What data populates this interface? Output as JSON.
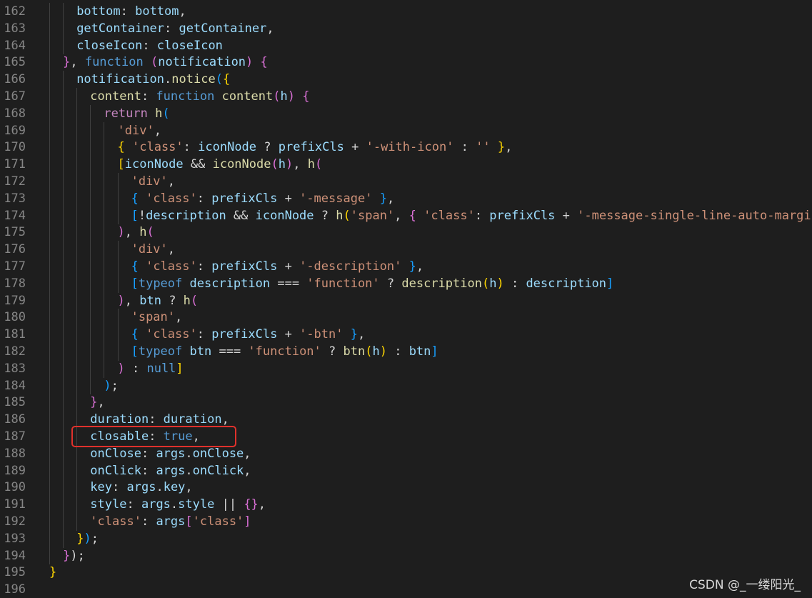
{
  "colors": {
    "default": "#d4d4d4",
    "variable": "#9cdcfe",
    "function": "#dcdcaa",
    "keyword": "#569cd6",
    "control": "#c586c0",
    "string": "#ce9178",
    "bracket1": "#ffd700",
    "bracket2": "#da70d6",
    "bracket3": "#179fff",
    "operator": "#d4d4d4",
    "highlight_border": "#e0312c"
  },
  "watermark": "CSDN @_一缕阳光_",
  "lines": [
    {
      "num": "162",
      "indent": 2,
      "tokens": [
        [
          "variable",
          "bottom"
        ],
        [
          "default",
          ": "
        ],
        [
          "variable",
          "bottom"
        ],
        [
          "default",
          ","
        ]
      ]
    },
    {
      "num": "163",
      "indent": 2,
      "tokens": [
        [
          "variable",
          "getContainer"
        ],
        [
          "default",
          ": "
        ],
        [
          "variable",
          "getContainer"
        ],
        [
          "default",
          ","
        ]
      ]
    },
    {
      "num": "164",
      "indent": 2,
      "tokens": [
        [
          "variable",
          "closeIcon"
        ],
        [
          "default",
          ": "
        ],
        [
          "variable",
          "closeIcon"
        ]
      ]
    },
    {
      "num": "165",
      "indent": 1,
      "tokens": [
        [
          "bracket2",
          "}"
        ],
        [
          "default",
          ", "
        ],
        [
          "keyword",
          "function"
        ],
        [
          "default",
          " "
        ],
        [
          "bracket2",
          "("
        ],
        [
          "variable",
          "notification"
        ],
        [
          "bracket2",
          ")"
        ],
        [
          "default",
          " "
        ],
        [
          "bracket2",
          "{"
        ]
      ]
    },
    {
      "num": "166",
      "indent": 2,
      "tokens": [
        [
          "variable",
          "notification"
        ],
        [
          "default",
          "."
        ],
        [
          "function",
          "notice"
        ],
        [
          "bracket3",
          "("
        ],
        [
          "bracket1",
          "{"
        ]
      ]
    },
    {
      "num": "167",
      "indent": 3,
      "tokens": [
        [
          "function",
          "content"
        ],
        [
          "default",
          ": "
        ],
        [
          "keyword",
          "function"
        ],
        [
          "default",
          " "
        ],
        [
          "function",
          "content"
        ],
        [
          "bracket2",
          "("
        ],
        [
          "variable",
          "h"
        ],
        [
          "bracket2",
          ")"
        ],
        [
          "default",
          " "
        ],
        [
          "bracket2",
          "{"
        ]
      ]
    },
    {
      "num": "168",
      "indent": 4,
      "tokens": [
        [
          "control",
          "return"
        ],
        [
          "default",
          " "
        ],
        [
          "function",
          "h"
        ],
        [
          "bracket3",
          "("
        ]
      ]
    },
    {
      "num": "169",
      "indent": 5,
      "tokens": [
        [
          "string",
          "'div'"
        ],
        [
          "default",
          ","
        ]
      ]
    },
    {
      "num": "170",
      "indent": 5,
      "tokens": [
        [
          "bracket1",
          "{"
        ],
        [
          "default",
          " "
        ],
        [
          "string",
          "'class'"
        ],
        [
          "default",
          ": "
        ],
        [
          "variable",
          "iconNode"
        ],
        [
          "default",
          " ? "
        ],
        [
          "variable",
          "prefixCls"
        ],
        [
          "default",
          " + "
        ],
        [
          "string",
          "'-with-icon'"
        ],
        [
          "default",
          " : "
        ],
        [
          "string",
          "''"
        ],
        [
          "default",
          " "
        ],
        [
          "bracket1",
          "}"
        ],
        [
          "default",
          ","
        ]
      ]
    },
    {
      "num": "171",
      "indent": 5,
      "tokens": [
        [
          "bracket1",
          "["
        ],
        [
          "variable",
          "iconNode"
        ],
        [
          "default",
          " && "
        ],
        [
          "function",
          "iconNode"
        ],
        [
          "bracket2",
          "("
        ],
        [
          "variable",
          "h"
        ],
        [
          "bracket2",
          ")"
        ],
        [
          "default",
          ", "
        ],
        [
          "function",
          "h"
        ],
        [
          "bracket2",
          "("
        ]
      ]
    },
    {
      "num": "172",
      "indent": 6,
      "tokens": [
        [
          "string",
          "'div'"
        ],
        [
          "default",
          ","
        ]
      ]
    },
    {
      "num": "173",
      "indent": 6,
      "tokens": [
        [
          "bracket3",
          "{"
        ],
        [
          "default",
          " "
        ],
        [
          "string",
          "'class'"
        ],
        [
          "default",
          ": "
        ],
        [
          "variable",
          "prefixCls"
        ],
        [
          "default",
          " + "
        ],
        [
          "string",
          "'-message'"
        ],
        [
          "default",
          " "
        ],
        [
          "bracket3",
          "}"
        ],
        [
          "default",
          ","
        ]
      ]
    },
    {
      "num": "174",
      "indent": 6,
      "tokens": [
        [
          "bracket3",
          "["
        ],
        [
          "default",
          "!"
        ],
        [
          "variable",
          "description"
        ],
        [
          "default",
          " && "
        ],
        [
          "variable",
          "iconNode"
        ],
        [
          "default",
          " ? "
        ],
        [
          "function",
          "h"
        ],
        [
          "bracket1",
          "("
        ],
        [
          "string",
          "'span'"
        ],
        [
          "default",
          ", "
        ],
        [
          "bracket2",
          "{"
        ],
        [
          "default",
          " "
        ],
        [
          "string",
          "'class'"
        ],
        [
          "default",
          ": "
        ],
        [
          "variable",
          "prefixCls"
        ],
        [
          "default",
          " + "
        ],
        [
          "string",
          "'-message-single-line-auto-margin'"
        ],
        [
          "default",
          " "
        ],
        [
          "bracket2",
          "}"
        ],
        [
          "bracket1",
          ")"
        ]
      ]
    },
    {
      "num": "175",
      "indent": 5,
      "tokens": [
        [
          "bracket2",
          ")"
        ],
        [
          "default",
          ", "
        ],
        [
          "function",
          "h"
        ],
        [
          "bracket2",
          "("
        ]
      ]
    },
    {
      "num": "176",
      "indent": 6,
      "tokens": [
        [
          "string",
          "'div'"
        ],
        [
          "default",
          ","
        ]
      ]
    },
    {
      "num": "177",
      "indent": 6,
      "tokens": [
        [
          "bracket3",
          "{"
        ],
        [
          "default",
          " "
        ],
        [
          "string",
          "'class'"
        ],
        [
          "default",
          ": "
        ],
        [
          "variable",
          "prefixCls"
        ],
        [
          "default",
          " + "
        ],
        [
          "string",
          "'-description'"
        ],
        [
          "default",
          " "
        ],
        [
          "bracket3",
          "}"
        ],
        [
          "default",
          ","
        ]
      ]
    },
    {
      "num": "178",
      "indent": 6,
      "tokens": [
        [
          "bracket3",
          "["
        ],
        [
          "keyword",
          "typeof"
        ],
        [
          "default",
          " "
        ],
        [
          "variable",
          "description"
        ],
        [
          "default",
          " === "
        ],
        [
          "string",
          "'function'"
        ],
        [
          "default",
          " ? "
        ],
        [
          "function",
          "description"
        ],
        [
          "bracket1",
          "("
        ],
        [
          "variable",
          "h"
        ],
        [
          "bracket1",
          ")"
        ],
        [
          "default",
          " : "
        ],
        [
          "variable",
          "description"
        ],
        [
          "bracket3",
          "]"
        ]
      ]
    },
    {
      "num": "179",
      "indent": 5,
      "tokens": [
        [
          "bracket2",
          ")"
        ],
        [
          "default",
          ", "
        ],
        [
          "variable",
          "btn"
        ],
        [
          "default",
          " ? "
        ],
        [
          "function",
          "h"
        ],
        [
          "bracket2",
          "("
        ]
      ]
    },
    {
      "num": "180",
      "indent": 6,
      "tokens": [
        [
          "string",
          "'span'"
        ],
        [
          "default",
          ","
        ]
      ]
    },
    {
      "num": "181",
      "indent": 6,
      "tokens": [
        [
          "bracket3",
          "{"
        ],
        [
          "default",
          " "
        ],
        [
          "string",
          "'class'"
        ],
        [
          "default",
          ": "
        ],
        [
          "variable",
          "prefixCls"
        ],
        [
          "default",
          " + "
        ],
        [
          "string",
          "'-btn'"
        ],
        [
          "default",
          " "
        ],
        [
          "bracket3",
          "}"
        ],
        [
          "default",
          ","
        ]
      ]
    },
    {
      "num": "182",
      "indent": 6,
      "tokens": [
        [
          "bracket3",
          "["
        ],
        [
          "keyword",
          "typeof"
        ],
        [
          "default",
          " "
        ],
        [
          "variable",
          "btn"
        ],
        [
          "default",
          " === "
        ],
        [
          "string",
          "'function'"
        ],
        [
          "default",
          " ? "
        ],
        [
          "function",
          "btn"
        ],
        [
          "bracket1",
          "("
        ],
        [
          "variable",
          "h"
        ],
        [
          "bracket1",
          ")"
        ],
        [
          "default",
          " : "
        ],
        [
          "variable",
          "btn"
        ],
        [
          "bracket3",
          "]"
        ]
      ]
    },
    {
      "num": "183",
      "indent": 5,
      "tokens": [
        [
          "bracket2",
          ")"
        ],
        [
          "default",
          " : "
        ],
        [
          "keyword",
          "null"
        ],
        [
          "bracket1",
          "]"
        ]
      ]
    },
    {
      "num": "184",
      "indent": 4,
      "tokens": [
        [
          "bracket3",
          ")"
        ],
        [
          "default",
          ";"
        ]
      ]
    },
    {
      "num": "185",
      "indent": 3,
      "tokens": [
        [
          "bracket2",
          "}"
        ],
        [
          "default",
          ","
        ]
      ]
    },
    {
      "num": "186",
      "indent": 3,
      "tokens": [
        [
          "variable",
          "duration"
        ],
        [
          "default",
          ": "
        ],
        [
          "variable",
          "duration"
        ],
        [
          "default",
          ","
        ]
      ]
    },
    {
      "num": "187",
      "indent": 3,
      "tokens": [
        [
          "variable",
          "closable"
        ],
        [
          "default",
          ": "
        ],
        [
          "keyword",
          "true"
        ],
        [
          "default",
          ","
        ]
      ]
    },
    {
      "num": "188",
      "indent": 3,
      "tokens": [
        [
          "variable",
          "onClose"
        ],
        [
          "default",
          ": "
        ],
        [
          "variable",
          "args"
        ],
        [
          "default",
          "."
        ],
        [
          "variable",
          "onClose"
        ],
        [
          "default",
          ","
        ]
      ]
    },
    {
      "num": "189",
      "indent": 3,
      "tokens": [
        [
          "variable",
          "onClick"
        ],
        [
          "default",
          ": "
        ],
        [
          "variable",
          "args"
        ],
        [
          "default",
          "."
        ],
        [
          "variable",
          "onClick"
        ],
        [
          "default",
          ","
        ]
      ]
    },
    {
      "num": "190",
      "indent": 3,
      "tokens": [
        [
          "variable",
          "key"
        ],
        [
          "default",
          ": "
        ],
        [
          "variable",
          "args"
        ],
        [
          "default",
          "."
        ],
        [
          "variable",
          "key"
        ],
        [
          "default",
          ","
        ]
      ]
    },
    {
      "num": "191",
      "indent": 3,
      "tokens": [
        [
          "variable",
          "style"
        ],
        [
          "default",
          ": "
        ],
        [
          "variable",
          "args"
        ],
        [
          "default",
          "."
        ],
        [
          "variable",
          "style"
        ],
        [
          "default",
          " || "
        ],
        [
          "bracket2",
          "{}"
        ],
        [
          "default",
          ","
        ]
      ]
    },
    {
      "num": "192",
      "indent": 3,
      "tokens": [
        [
          "string",
          "'class'"
        ],
        [
          "default",
          ": "
        ],
        [
          "variable",
          "args"
        ],
        [
          "bracket2",
          "["
        ],
        [
          "string",
          "'class'"
        ],
        [
          "bracket2",
          "]"
        ]
      ]
    },
    {
      "num": "193",
      "indent": 2,
      "tokens": [
        [
          "bracket1",
          "}"
        ],
        [
          "bracket3",
          ")"
        ],
        [
          "default",
          ";"
        ]
      ]
    },
    {
      "num": "194",
      "indent": 1,
      "tokens": [
        [
          "bracket2",
          "}"
        ],
        [
          "default",
          ");"
        ]
      ]
    },
    {
      "num": "195",
      "indent": 0,
      "tokens": [
        [
          "bracket1",
          "}"
        ]
      ]
    },
    {
      "num": "196",
      "indent": 0,
      "tokens": []
    }
  ]
}
